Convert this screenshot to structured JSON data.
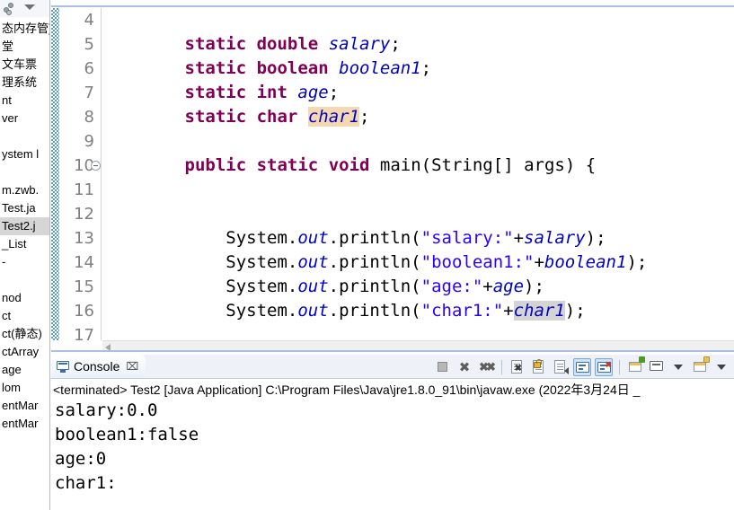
{
  "sidebar": {
    "toolbar": {
      "link_with_editor": "link-with-editor-icon",
      "view_menu": "view-menu-icon"
    },
    "items": [
      {
        "label": "态内存管]",
        "selected": false
      },
      {
        "label": "堂",
        "selected": false
      },
      {
        "label": "文车票",
        "selected": false
      },
      {
        "label": "理系统",
        "selected": false
      },
      {
        "label": "nt",
        "selected": false
      },
      {
        "label": "ver",
        "selected": false
      },
      {
        "label": "",
        "selected": false
      },
      {
        "label": "ystem l",
        "selected": false
      },
      {
        "label": "",
        "selected": false
      },
      {
        "label": "m.zwb.",
        "selected": false
      },
      {
        "label": "Test.ja",
        "selected": false
      },
      {
        "label": "Test2.j",
        "selected": true
      },
      {
        "label": "_List",
        "selected": false
      },
      {
        "label": "-",
        "selected": false
      },
      {
        "label": "",
        "selected": false
      },
      {
        "label": "nod",
        "selected": false
      },
      {
        "label": "ct",
        "selected": false
      },
      {
        "label": "ct(静态)",
        "selected": false
      },
      {
        "label": "ctArray",
        "selected": false
      },
      {
        "label": "age",
        "selected": false
      },
      {
        "label": "lom",
        "selected": false
      },
      {
        "label": "entMar",
        "selected": false
      },
      {
        "label": "entMar",
        "selected": false
      }
    ]
  },
  "editor": {
    "line_numbers": [
      "4",
      "5",
      "6",
      "7",
      "8",
      "9",
      "10",
      "11",
      "12",
      "13",
      "14",
      "15",
      "16",
      "17"
    ],
    "fold_marker_line": "10",
    "lines": [
      {
        "n": "4",
        "tokens": []
      },
      {
        "n": "5",
        "tokens": [
          {
            "t": "        ",
            "c": "plain"
          },
          {
            "t": "static",
            "c": "kw"
          },
          {
            "t": " ",
            "c": "plain"
          },
          {
            "t": "double",
            "c": "kw"
          },
          {
            "t": " ",
            "c": "plain"
          },
          {
            "t": "salary",
            "c": "fld"
          },
          {
            "t": ";",
            "c": "plain"
          }
        ]
      },
      {
        "n": "6",
        "tokens": [
          {
            "t": "        ",
            "c": "plain"
          },
          {
            "t": "static",
            "c": "kw"
          },
          {
            "t": " ",
            "c": "plain"
          },
          {
            "t": "boolean",
            "c": "kw"
          },
          {
            "t": " ",
            "c": "plain"
          },
          {
            "t": "boolean1",
            "c": "fld"
          },
          {
            "t": ";",
            "c": "plain"
          }
        ]
      },
      {
        "n": "7",
        "tokens": [
          {
            "t": "        ",
            "c": "plain"
          },
          {
            "t": "static",
            "c": "kw"
          },
          {
            "t": " ",
            "c": "plain"
          },
          {
            "t": "int",
            "c": "kw"
          },
          {
            "t": " ",
            "c": "plain"
          },
          {
            "t": "age",
            "c": "fld"
          },
          {
            "t": ";",
            "c": "plain"
          }
        ]
      },
      {
        "n": "8",
        "tokens": [
          {
            "t": "        ",
            "c": "plain"
          },
          {
            "t": "static",
            "c": "kw"
          },
          {
            "t": " ",
            "c": "plain"
          },
          {
            "t": "char",
            "c": "kw"
          },
          {
            "t": " ",
            "c": "plain"
          },
          {
            "t": "char1",
            "c": "fld occ-write"
          },
          {
            "t": ";",
            "c": "plain"
          }
        ]
      },
      {
        "n": "9",
        "tokens": []
      },
      {
        "n": "10",
        "tokens": [
          {
            "t": "        ",
            "c": "plain"
          },
          {
            "t": "public",
            "c": "kw"
          },
          {
            "t": " ",
            "c": "plain"
          },
          {
            "t": "static",
            "c": "kw"
          },
          {
            "t": " ",
            "c": "plain"
          },
          {
            "t": "void",
            "c": "kw"
          },
          {
            "t": " ",
            "c": "plain"
          },
          {
            "t": "main(String[] args) {",
            "c": "plain"
          }
        ]
      },
      {
        "n": "11",
        "tokens": []
      },
      {
        "n": "12",
        "tokens": []
      },
      {
        "n": "13",
        "tokens": [
          {
            "t": "            System.",
            "c": "plain"
          },
          {
            "t": "out",
            "c": "fld"
          },
          {
            "t": ".println(",
            "c": "plain"
          },
          {
            "t": "\"salary:\"",
            "c": "str"
          },
          {
            "t": "+",
            "c": "plain"
          },
          {
            "t": "salary",
            "c": "fld"
          },
          {
            "t": ");",
            "c": "plain"
          }
        ]
      },
      {
        "n": "14",
        "tokens": [
          {
            "t": "            System.",
            "c": "plain"
          },
          {
            "t": "out",
            "c": "fld"
          },
          {
            "t": ".println(",
            "c": "plain"
          },
          {
            "t": "\"boolean1:\"",
            "c": "str"
          },
          {
            "t": "+",
            "c": "plain"
          },
          {
            "t": "boolean1",
            "c": "fld"
          },
          {
            "t": ");",
            "c": "plain"
          }
        ]
      },
      {
        "n": "15",
        "tokens": [
          {
            "t": "            System.",
            "c": "plain"
          },
          {
            "t": "out",
            "c": "fld"
          },
          {
            "t": ".println(",
            "c": "plain"
          },
          {
            "t": "\"age:\"",
            "c": "str"
          },
          {
            "t": "+",
            "c": "plain"
          },
          {
            "t": "age",
            "c": "fld"
          },
          {
            "t": ");",
            "c": "plain"
          }
        ]
      },
      {
        "n": "16",
        "tokens": [
          {
            "t": "            System.",
            "c": "plain"
          },
          {
            "t": "out",
            "c": "fld"
          },
          {
            "t": ".println(",
            "c": "plain"
          },
          {
            "t": "\"char1:\"",
            "c": "str"
          },
          {
            "t": "+",
            "c": "plain"
          },
          {
            "t": "char1",
            "c": "fld occ-read"
          },
          {
            "t": ");",
            "c": "plain"
          }
        ]
      },
      {
        "n": "17",
        "tokens": []
      }
    ]
  },
  "console": {
    "tab_label": "Console",
    "close_glyph": "⌧",
    "terminated_line": "<terminated> Test2 [Java Application] C:\\Program Files\\Java\\jre1.8.0_91\\bin\\javaw.exe (2022年3月24日 _",
    "output_lines": [
      "salary:0.0",
      "boolean1:false",
      "age:0",
      "char1:"
    ],
    "toolbar_icons": [
      "terminate-icon",
      "remove-launch-icon",
      "remove-all-terminated-icon",
      "clear-console-icon",
      "scroll-lock-icon",
      "word-wrap-icon",
      "show-console-on-output-icon",
      "show-console-on-error-icon",
      "open-console-icon",
      "display-selected-console-icon",
      "display-selected-console-menu-icon",
      "new-console-view-icon",
      "new-console-view-menu-icon"
    ]
  },
  "colors": {
    "keyword": "#7f0055",
    "field": "#0000c0",
    "string": "#2a00ff",
    "occurrence_write": "#f4d9b0",
    "occurrence_read": "#d4d4d4",
    "changebar": "#5b9bd5",
    "tab_border": "#aac0de"
  }
}
